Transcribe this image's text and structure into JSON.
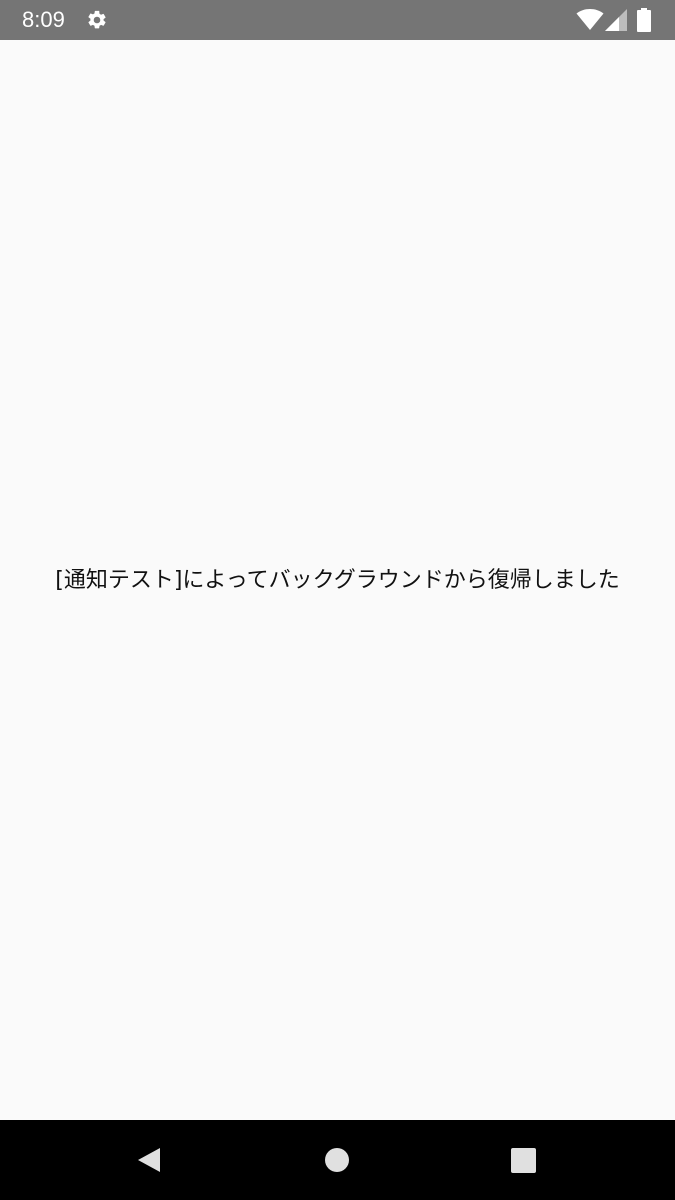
{
  "status_bar": {
    "time": "8:09",
    "icons": [
      "settings-icon",
      "wifi-icon",
      "cell-signal-icon",
      "battery-icon"
    ],
    "background_color": "#757575"
  },
  "main": {
    "message": "[通知テスト]によってバックグラウンドから復帰しました",
    "background_color": "#fafafa"
  },
  "nav_bar": {
    "buttons": [
      "back",
      "home",
      "recents"
    ],
    "background_color": "#000000"
  }
}
